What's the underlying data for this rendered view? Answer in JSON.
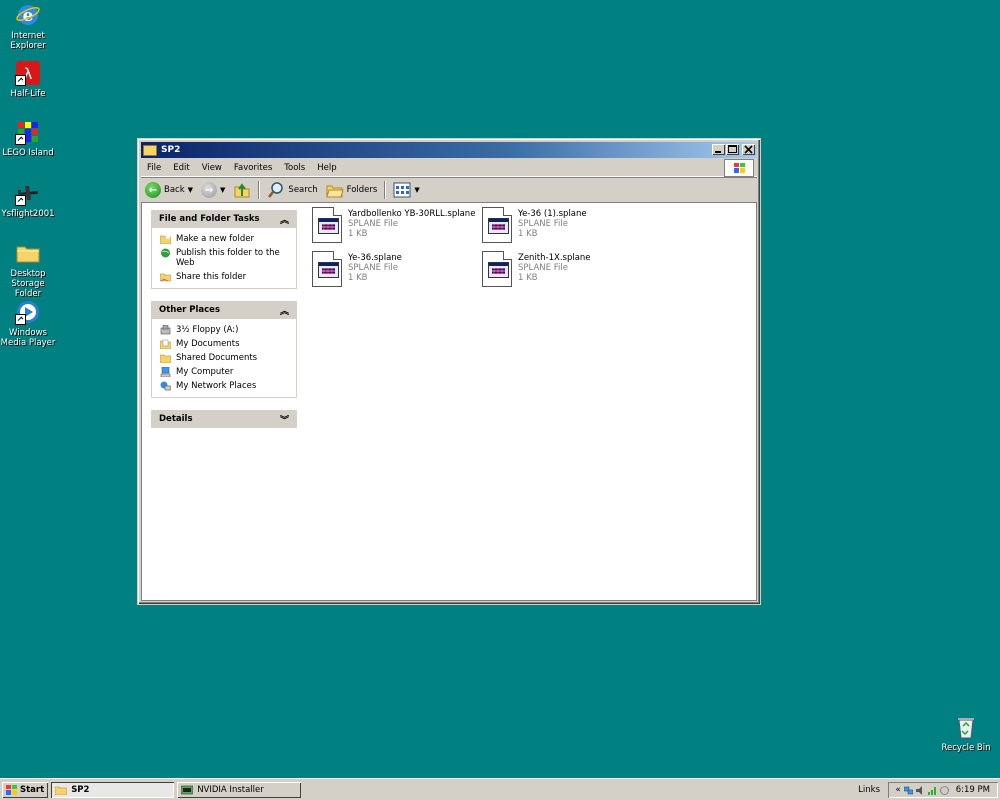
{
  "desktop": {
    "icons": [
      {
        "label": "Internet\nExplorer"
      },
      {
        "label": "Half-Life"
      },
      {
        "label": "LEGO Island"
      },
      {
        "label": "Ysflight2001"
      },
      {
        "label": "Desktop\nStorage Folder"
      },
      {
        "label": "Windows\nMedia Player"
      },
      {
        "label": "Recycle Bin"
      }
    ]
  },
  "window": {
    "title": "SP2",
    "menu": [
      "File",
      "Edit",
      "View",
      "Favorites",
      "Tools",
      "Help"
    ],
    "toolbar": {
      "back": "Back",
      "search": "Search",
      "folders": "Folders"
    },
    "file_folder_tasks": {
      "title": "File and Folder Tasks",
      "items": [
        "Make a new folder",
        "Publish this folder to the Web",
        "Share this folder"
      ]
    },
    "other_places": {
      "title": "Other Places",
      "items": [
        "3½ Floppy (A:)",
        "My Documents",
        "Shared Documents",
        "My Computer",
        "My Network Places"
      ]
    },
    "details": {
      "title": "Details"
    },
    "files": [
      {
        "name": "Yardbollenko YB-30RLL.splane",
        "type": "SPLANE File",
        "size": "1 KB"
      },
      {
        "name": "Ye-36 (1).splane",
        "type": "SPLANE File",
        "size": "1 KB"
      },
      {
        "name": "Ye-36.splane",
        "type": "SPLANE File",
        "size": "1 KB"
      },
      {
        "name": "Zenith-1X.splane",
        "type": "SPLANE File",
        "size": "1 KB"
      }
    ]
  },
  "taskbar": {
    "start": "Start",
    "tasks": [
      "SP2",
      "NVIDIA Installer"
    ],
    "links": "Links",
    "chevron": "«",
    "clock": "6:19 PM"
  },
  "colors": {
    "desktop": "#008080",
    "title_active": "#0a246a"
  }
}
